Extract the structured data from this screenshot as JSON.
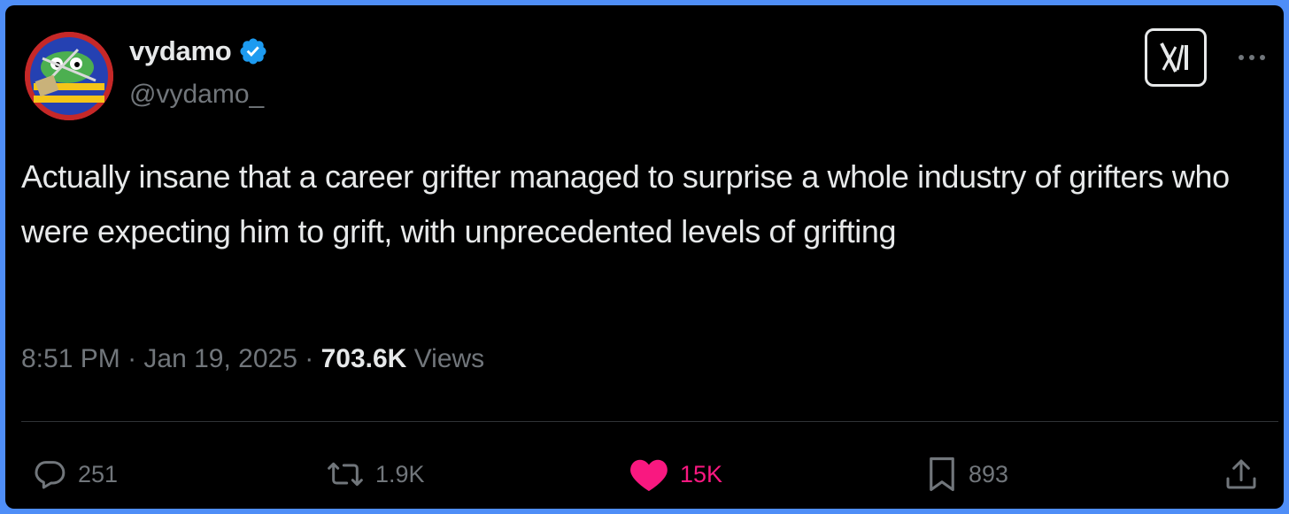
{
  "author": {
    "display_name": "vydamo",
    "handle": "@vydamo_",
    "verified": true
  },
  "tweet": {
    "text": "Actually insane that a career grifter managed to surprise a whole industry of grifters who were expecting him to grift, with unprecedented levels of grifting",
    "time": "8:51 PM",
    "date": "Jan 19, 2025",
    "separator": "·",
    "views_count": "703.6K",
    "views_label": "Views"
  },
  "actions": {
    "replies": "251",
    "reposts": "1.9K",
    "likes": "15K",
    "bookmarks": "893"
  },
  "icons": {
    "logo": "x-logo-icon",
    "more": "more-options-icon",
    "reply": "reply-icon",
    "repost": "repost-icon",
    "like": "heart-icon",
    "bookmark": "bookmark-icon",
    "share": "share-icon",
    "verified": "verified-badge-icon"
  },
  "colors": {
    "background": "#000000",
    "frame": "#4f8ef7",
    "text": "#e7e9ea",
    "secondary_text": "#71767b",
    "verified": "#1d9bf0",
    "like": "#f91880"
  }
}
